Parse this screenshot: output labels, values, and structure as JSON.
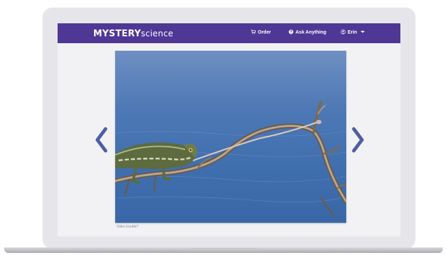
{
  "navbar": {
    "logo_bold": "MYSTERY",
    "logo_light": "science",
    "order_label": "Order",
    "ask_label": "Ask Anything",
    "user_label": "Erin"
  },
  "video": {
    "trouble_link": "Video trouble?"
  },
  "icons": {
    "order": "cart-icon",
    "ask": "question-circle-icon",
    "user": "user-circle-icon",
    "user_menu": "caret-down-icon",
    "prev": "chevron-left-icon",
    "next": "chevron-right-icon"
  },
  "colors": {
    "navbar": "#4f3796",
    "arrows": "#4e5ea6",
    "screen_background": "#f2f2f4",
    "laptop_bezel": "#e6e6ea"
  }
}
